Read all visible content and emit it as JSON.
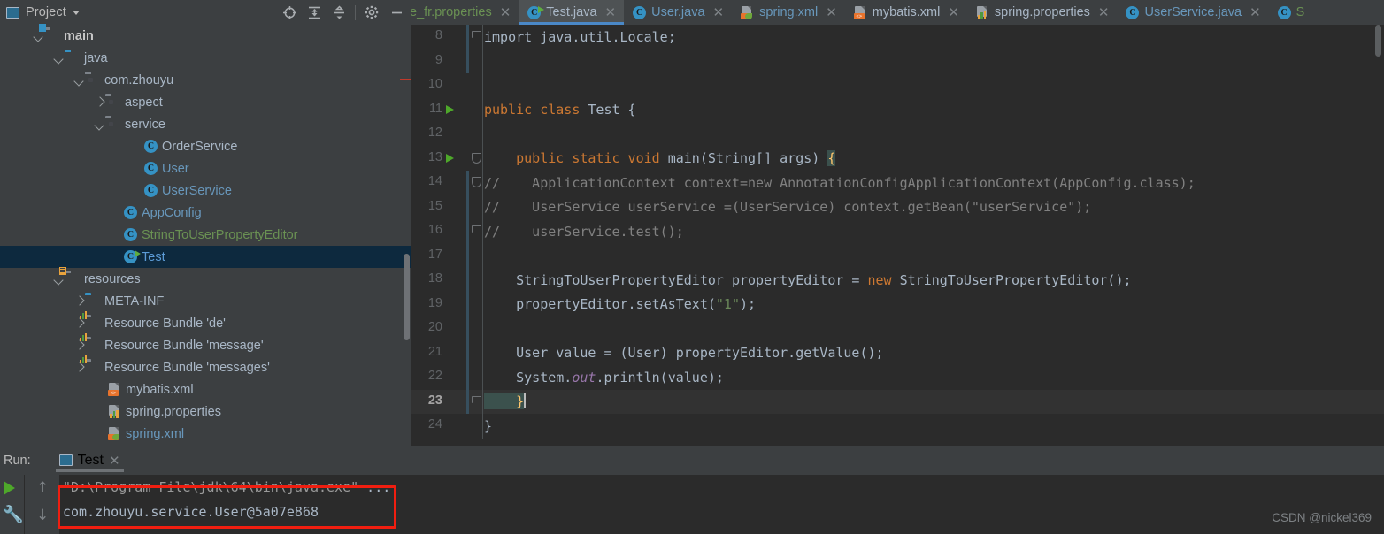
{
  "project_panel": {
    "title": "Project",
    "caret_icon": "chevron-down-icon",
    "toolbar": [
      {
        "name": "locate-icon",
        "label": "⊕"
      },
      {
        "name": "expand-all-icon",
        "label": ""
      },
      {
        "name": "collapse-all-icon",
        "label": ""
      },
      {
        "name": "settings-gear-icon",
        "label": "⚙"
      },
      {
        "name": "hide-icon",
        "label": "—"
      }
    ],
    "tree": [
      {
        "label": "main",
        "type": "folder-source",
        "arrow": "down",
        "indent": 50,
        "color": "bold",
        "selected": false
      },
      {
        "label": "java",
        "type": "folder-blue",
        "arrow": "down",
        "indent": 73,
        "color": "gray",
        "selected": false
      },
      {
        "label": "com.zhouyu",
        "type": "folder-package",
        "arrow": "down",
        "indent": 96,
        "color": "gray",
        "selected": false
      },
      {
        "label": "aspect",
        "type": "folder-package",
        "arrow": "right",
        "indent": 119,
        "color": "gray",
        "selected": false
      },
      {
        "label": "service",
        "type": "folder-package",
        "arrow": "down",
        "indent": 119,
        "color": "gray",
        "selected": false
      },
      {
        "label": "OrderService",
        "type": "class",
        "arrow": "none",
        "indent": 163,
        "color": "gray",
        "selected": false
      },
      {
        "label": "User",
        "type": "class",
        "arrow": "none",
        "indent": 163,
        "color": "blue",
        "selected": false
      },
      {
        "label": "UserService",
        "type": "class",
        "arrow": "none",
        "indent": 163,
        "color": "blue",
        "selected": false
      },
      {
        "label": "AppConfig",
        "type": "class",
        "arrow": "none",
        "indent": 140,
        "color": "blue",
        "selected": false
      },
      {
        "label": "StringToUserPropertyEditor",
        "type": "class",
        "arrow": "none",
        "indent": 140,
        "color": "green",
        "selected": false
      },
      {
        "label": "Test",
        "type": "class-runnable",
        "arrow": "none",
        "indent": 140,
        "color": "selblue",
        "selected": true
      },
      {
        "label": "resources",
        "type": "folder-resource",
        "arrow": "down",
        "indent": 73,
        "color": "gray",
        "selected": false
      },
      {
        "label": "META-INF",
        "type": "folder-blue",
        "arrow": "right",
        "indent": 96,
        "color": "gray",
        "selected": false
      },
      {
        "label": "Resource Bundle 'de'",
        "type": "folder-bundle",
        "arrow": "right",
        "indent": 96,
        "color": "gray",
        "selected": false
      },
      {
        "label": "Resource Bundle 'message'",
        "type": "folder-bundle",
        "arrow": "right",
        "indent": 96,
        "color": "gray",
        "selected": false
      },
      {
        "label": "Resource Bundle 'messages'",
        "type": "folder-bundle",
        "arrow": "right",
        "indent": 96,
        "color": "gray",
        "selected": false
      },
      {
        "label": "mybatis.xml",
        "type": "file-xml",
        "arrow": "none",
        "indent": 122,
        "color": "gray",
        "selected": false
      },
      {
        "label": "spring.properties",
        "type": "file-properties",
        "arrow": "none",
        "indent": 122,
        "color": "gray",
        "selected": false
      },
      {
        "label": "spring.xml",
        "type": "file-spring-xml",
        "arrow": "none",
        "indent": 122,
        "color": "blue",
        "selected": false
      }
    ]
  },
  "editor": {
    "tabs": [
      {
        "label": "e_fr.properties",
        "icon": "properties-file-icon",
        "color": "green",
        "active": false,
        "closable": true,
        "clipped_left": true
      },
      {
        "label": "Test.java",
        "icon": "java-runnable-icon",
        "color": "gray",
        "active": true,
        "closable": true,
        "clipped_left": false
      },
      {
        "label": "User.java",
        "icon": "java-class-icon",
        "color": "blue",
        "active": false,
        "closable": true,
        "clipped_left": false
      },
      {
        "label": "spring.xml",
        "icon": "spring-xml-icon",
        "color": "blue",
        "active": false,
        "closable": true,
        "clipped_left": false
      },
      {
        "label": "mybatis.xml",
        "icon": "xml-file-icon",
        "color": "gray",
        "active": false,
        "closable": true,
        "clipped_left": false
      },
      {
        "label": "spring.properties",
        "icon": "properties-file-icon",
        "color": "gray",
        "active": false,
        "closable": true,
        "clipped_left": false
      },
      {
        "label": "UserService.java",
        "icon": "java-class-icon",
        "color": "blue",
        "active": false,
        "closable": true,
        "clipped_left": false
      },
      {
        "label": "S",
        "icon": "java-class-icon",
        "color": "green",
        "active": false,
        "closable": false,
        "clipped_left": false
      }
    ],
    "lines": [
      {
        "no": "8",
        "run": false,
        "fold": "end",
        "change": true,
        "current": false,
        "tokens": [
          {
            "t": "import java.util.Locale;",
            "c": "plain"
          }
        ]
      },
      {
        "no": "9",
        "run": false,
        "fold": "none",
        "change": true,
        "current": false,
        "tokens": []
      },
      {
        "no": "10",
        "run": false,
        "fold": "none",
        "change": false,
        "current": false,
        "tokens": []
      },
      {
        "no": "11",
        "run": true,
        "fold": "none",
        "change": false,
        "current": false,
        "tokens": [
          {
            "t": "public class ",
            "c": "kw"
          },
          {
            "t": "Test {",
            "c": "plain"
          }
        ]
      },
      {
        "no": "12",
        "run": false,
        "fold": "none",
        "change": false,
        "current": false,
        "tokens": []
      },
      {
        "no": "13",
        "run": true,
        "fold": "down",
        "change": false,
        "current": false,
        "tokens": [
          {
            "t": "    public static void ",
            "c": "kw"
          },
          {
            "t": "main(String[] args) ",
            "c": "plain"
          },
          {
            "t": "{",
            "c": "brace"
          }
        ]
      },
      {
        "no": "14",
        "run": false,
        "fold": "down",
        "change": true,
        "current": false,
        "tokens": [
          {
            "t": "//    ApplicationContext context=new AnnotationConfigApplicationContext(AppConfig.class);",
            "c": "comment"
          }
        ]
      },
      {
        "no": "15",
        "run": false,
        "fold": "none",
        "change": true,
        "current": false,
        "tokens": [
          {
            "t": "//    UserService userService =(UserService) context.getBean(\"userService\");",
            "c": "comment"
          }
        ]
      },
      {
        "no": "16",
        "run": false,
        "fold": "end",
        "change": true,
        "current": false,
        "tokens": [
          {
            "t": "//    userService.test();",
            "c": "comment"
          }
        ]
      },
      {
        "no": "17",
        "run": false,
        "fold": "none",
        "change": true,
        "current": false,
        "tokens": []
      },
      {
        "no": "18",
        "run": false,
        "fold": "none",
        "change": true,
        "current": false,
        "tokens": [
          {
            "t": "    StringToUserPropertyEditor propertyEditor = ",
            "c": "plain"
          },
          {
            "t": "new ",
            "c": "kw"
          },
          {
            "t": "StringToUserPropertyEditor();",
            "c": "plain"
          }
        ]
      },
      {
        "no": "19",
        "run": false,
        "fold": "none",
        "change": true,
        "current": false,
        "tokens": [
          {
            "t": "    propertyEditor.setAsText(",
            "c": "plain"
          },
          {
            "t": "\"1\"",
            "c": "string"
          },
          {
            "t": ");",
            "c": "plain"
          }
        ]
      },
      {
        "no": "20",
        "run": false,
        "fold": "none",
        "change": true,
        "current": false,
        "tokens": []
      },
      {
        "no": "21",
        "run": false,
        "fold": "none",
        "change": true,
        "current": false,
        "tokens": [
          {
            "t": "    User value = (User) propertyEditor.getValue();",
            "c": "plain"
          }
        ]
      },
      {
        "no": "22",
        "run": false,
        "fold": "none",
        "change": true,
        "current": false,
        "tokens": [
          {
            "t": "    System.",
            "c": "plain"
          },
          {
            "t": "out",
            "c": "field"
          },
          {
            "t": ".println(value);",
            "c": "plain"
          }
        ]
      },
      {
        "no": "23",
        "run": false,
        "fold": "end",
        "change": true,
        "current": true,
        "tokens": [
          {
            "t": "    }",
            "c": "brace"
          },
          {
            "t": "",
            "c": "cursor"
          }
        ]
      },
      {
        "no": "24",
        "run": false,
        "fold": "none",
        "change": false,
        "current": false,
        "tokens": [
          {
            "t": "}",
            "c": "plain"
          }
        ]
      }
    ]
  },
  "run_panel": {
    "label": "Run:",
    "tab_label": "Test",
    "tab_icon": "run-config-icon",
    "close_icon": "close-icon",
    "play_icon": "rerun-play-icon",
    "wrench_icon": "wrench-icon",
    "up_icon": "↑",
    "down_icon": "↓",
    "console_lines": [
      {
        "text": "\"D:\\Program File\\jdk\\64\\bin\\java.exe\"",
        "suffix": " ..."
      },
      {
        "text": "com.zhouyu.service.User@5a07e868",
        "suffix": ""
      }
    ],
    "highlight_color": "#F01E10"
  },
  "watermark": "CSDN @nickel369"
}
